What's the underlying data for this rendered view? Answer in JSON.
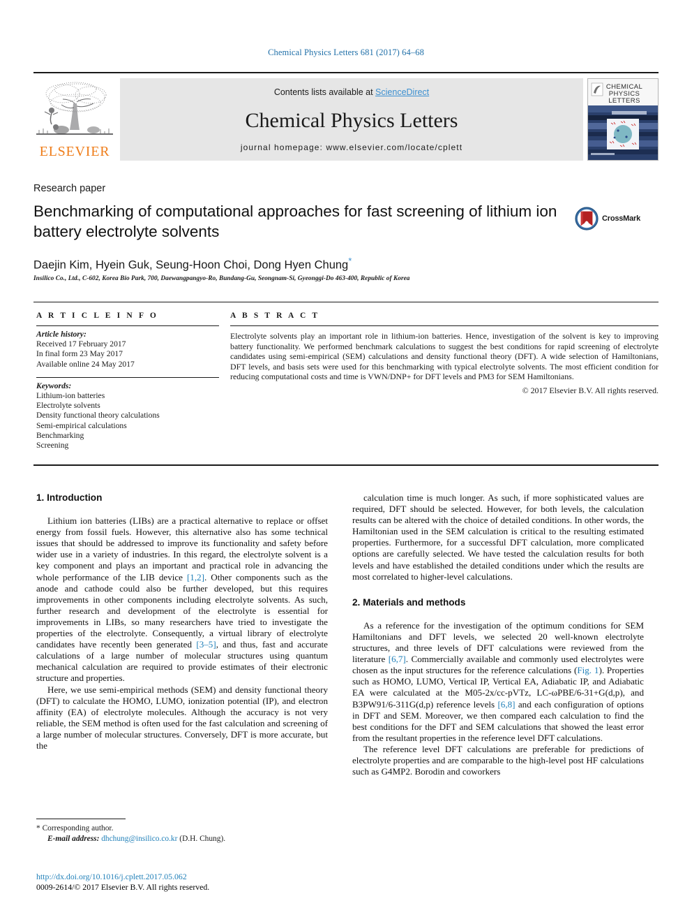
{
  "running_head": "Chemical Physics Letters 681 (2017) 64–68",
  "masthead": {
    "publisher_name": "ELSEVIER",
    "contents_prefix": "Contents lists available at ",
    "sciencedirect": "ScienceDirect",
    "journal_title": "Chemical Physics Letters",
    "homepage": "journal homepage: www.elsevier.com/locate/cplett",
    "cover": {
      "line1": "CHEMICAL",
      "line2": "PHYSICS",
      "line3": "LETTERS"
    }
  },
  "article": {
    "type": "Research paper",
    "title": "Benchmarking of computational approaches for fast screening of lithium ion battery electrolyte solvents",
    "crossmark_label": "CrossMark",
    "authors": "Daejin Kim, Hyein Guk, Seung-Hoon Choi, Dong Hyen Chung",
    "corresponding_marker": "*",
    "affiliation": "Insilico Co., Ltd., C-602, Korea Bio Park, 700, Daewangpangyo-Ro, Bundang-Gu, Seongnam-Si, Gyeonggi-Do 463-400, Republic of Korea"
  },
  "article_info": {
    "heading": "A R T I C L E   I N F O",
    "history_label": "Article history:",
    "history": [
      "Received 17 February 2017",
      "In final form 23 May 2017",
      "Available online 24 May 2017"
    ],
    "keywords_label": "Keywords:",
    "keywords": [
      "Lithium-ion batteries",
      "Electrolyte solvents",
      "Density functional theory calculations",
      "Semi-empirical calculations",
      "Benchmarking",
      "Screening"
    ]
  },
  "abstract": {
    "heading": "A B S T R A C T",
    "text": "Electrolyte solvents play an important role in lithium-ion batteries. Hence, investigation of the solvent is key to improving battery functionality. We performed benchmark calculations to suggest the best conditions for rapid screening of electrolyte candidates using semi-empirical (SEM) calculations and density functional theory (DFT). A wide selection of Hamiltonians, DFT levels, and basis sets were used for this benchmarking with typical electrolyte solvents. The most efficient condition for reducing computational costs and time is VWN/DNP+ for DFT levels and PM3 for SEM Hamiltonians.",
    "copyright": "© 2017 Elsevier B.V. All rights reserved."
  },
  "body": {
    "intro_heading": "1. Introduction",
    "intro_p1_a": "Lithium ion batteries (LIBs) are a practical alternative to replace or offset energy from fossil fuels. However, this alternative also has some technical issues that should be addressed to improve its functionality and safety before wider use in a variety of industries. In this regard, the electrolyte solvent is a key component and plays an important and practical role in advancing the whole performance of the LIB device ",
    "intro_p1_ref1": "[1,2]",
    "intro_p1_b": ". Other components such as the anode and cathode could also be further developed, but this requires improvements in other components including electrolyte solvents. As such, further research and development of the electrolyte is essential for improvements in LIBs, so many researchers have tried to investigate the properties of the electrolyte. Consequently, a virtual library of electrolyte candidates have recently been generated ",
    "intro_p1_ref2": "[3–5]",
    "intro_p1_c": ", and thus, fast and accurate calculations of a large number of molecular structures using quantum mechanical calculation are required to provide estimates of their electronic structure and properties.",
    "intro_p2": "Here, we use semi-empirical methods (SEM) and density functional theory (DFT) to calculate the HOMO, LUMO, ionization potential (IP), and electron affinity (EA) of electrolyte molecules. Although the accuracy is not very reliable, the SEM method is often used for the fast calculation and screening of a large number of molecular structures. Conversely, DFT is more accurate, but the",
    "right_p1": "calculation time is much longer. As such, if more sophisticated values are required, DFT should be selected. However, for both levels, the calculation results can be altered with the choice of detailed conditions. In other words, the Hamiltonian used in the SEM calculation is critical to the resulting estimated properties. Furthermore, for a successful DFT calculation, more complicated options are carefully selected. We have tested the calculation results for both levels and have established the detailed conditions under which the results are most correlated to higher-level calculations.",
    "methods_heading": "2. Materials and methods",
    "methods_p1_a": "As a reference for the investigation of the optimum conditions for SEM Hamiltonians and DFT levels, we selected 20 well-known electrolyte structures, and three levels of DFT calculations were reviewed from the literature ",
    "methods_p1_ref1": "[6,7]",
    "methods_p1_b": ". Commercially available and commonly used electrolytes were chosen as the input structures for the reference calculations (",
    "methods_p1_fig": "Fig. 1",
    "methods_p1_c": "). Properties such as HOMO, LUMO, Vertical IP, Vertical EA, Adiabatic IP, and Adiabatic EA were calculated at the M05-2x/cc-pVTz, LC-ωPBE/6-31+G(d,p), and B3PW91/6-311G(d,p) reference levels ",
    "methods_p1_ref2": "[6,8]",
    "methods_p1_d": " and each configuration of options in DFT and SEM. Moreover, we then compared each calculation to find the best conditions for the DFT and SEM calculations that showed the least error from the resultant properties in the reference level DFT calculations.",
    "methods_p2": "The reference level DFT calculations are preferable for predictions of electrolyte properties and are comparable to the high-level post HF calculations such as G4MP2. Borodin and coworkers"
  },
  "footer": {
    "corresponding_marker": "*",
    "corresponding_label": "Corresponding author.",
    "email_label": "E-mail address:",
    "email": "dhchung@insilico.co.kr",
    "email_suffix": "(D.H. Chung).",
    "doi": "http://dx.doi.org/10.1016/j.cplett.2017.05.062",
    "issn_line": "0009-2614/© 2017 Elsevier B.V. All rights reserved."
  },
  "colors": {
    "link_blue": "#1f7fb8",
    "sciencedirect_blue": "#3b8fd0",
    "elsevier_orange": "#ef7d1a",
    "band_grey": "#e6e6e6"
  }
}
